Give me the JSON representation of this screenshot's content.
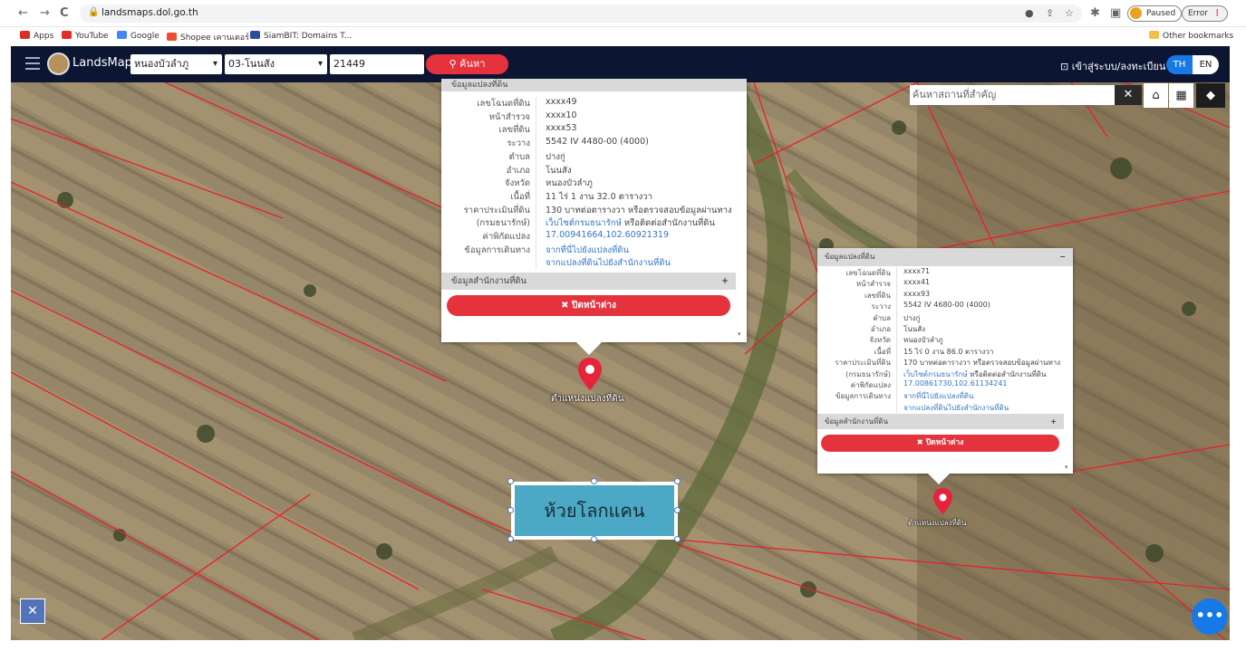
{
  "browser": {
    "url": "landsmaps.dol.go.th",
    "nav": {
      "back": "←",
      "forward": "→",
      "reload": "C"
    },
    "profile_status": "Paused",
    "error_chip": "Error",
    "bookmarks": [
      {
        "label": "Apps",
        "color": "#d93025"
      },
      {
        "label": "YouTube",
        "color": "#e52d27"
      },
      {
        "label": "Google",
        "color": "#4285f4"
      },
      {
        "label": "Shopee เคานเตอร์",
        "color": "#ee4d2d"
      },
      {
        "label": "SiamBIT: Domains T...",
        "color": "#2c4d9c"
      }
    ],
    "other_bookmarks": "Other bookmarks"
  },
  "topnav": {
    "brand": "LandsMaps",
    "province": "หนองบัวลำภู",
    "district": "03-โนนสัง",
    "parcel_no": "21449",
    "search_label": "ค้นหา",
    "login_label": "เข้าสู่ระบบ/ลงทะเบียน",
    "lang_th": "TH",
    "lang_en": "EN"
  },
  "map": {
    "search_placeholder": "ค้นหาสถานที่สำคัญ",
    "stream_label": "ห้วยโลกแคน",
    "colors": {
      "parcel_line": "#e8202a",
      "accent_red": "#e5333d",
      "nav_bg": "#0c1633",
      "link": "#3476c9"
    }
  },
  "popup_left": {
    "header": "ข้อมูลแปลงที่ดิน",
    "rows": [
      {
        "k": "เลขโฉนดที่ดิน",
        "v": "xxxx49"
      },
      {
        "k": "หน้าสำรวจ",
        "v": "xxxx10"
      },
      {
        "k": "เลขที่ดิน",
        "v": "xxxx53"
      },
      {
        "k": "ระวาง",
        "v": "5542 IV 4480-00 (4000)"
      },
      {
        "k": "ตำบล",
        "v": "ปางกู่"
      },
      {
        "k": "อำเภอ",
        "v": "โนนสัง"
      },
      {
        "k": "จังหวัด",
        "v": "หนองบัวลำภู"
      },
      {
        "k": "เนื้อที่",
        "v": "11 ไร่ 1 งาน 32.0 ตารางวา"
      },
      {
        "k": "ราคาประเมินที่ดิน",
        "v": "130 บาทต่อตารางวา หรือตรวจสอบข้อมูลผ่านทาง"
      },
      {
        "k": "(กรมธนารักษ์)",
        "v": "เว็บไซต์กรมธนารักษ์",
        "v2": " หรือติดต่อสำนักงานที่ดิน"
      },
      {
        "k": "ค่าพิกัดแปลง",
        "v": "17.00941664,102.60921319"
      },
      {
        "k": "ข้อมูลการเดินทาง",
        "v": "จากที่นี่ไปยังแปลงที่ดิน"
      },
      {
        "k": "",
        "v": "จากแปลงที่ดินไปยังสำนักงานที่ดิน"
      }
    ],
    "office_header": "ข้อมูลสำนักงานที่ดิน",
    "office_toggle": "+",
    "close_label": "✖ ปิดหน้าต่าง"
  },
  "popup_right": {
    "header": "ข้อมูลแปลงที่ดิน",
    "toggle": "−",
    "rows": [
      {
        "k": "เลขโฉนดที่ดิน",
        "v": "xxxx71"
      },
      {
        "k": "หน้าสำรวจ",
        "v": "xxxx41"
      },
      {
        "k": "เลขที่ดิน",
        "v": "xxxx93"
      },
      {
        "k": "ระวาง",
        "v": "5542 IV 4680-00 (4000)"
      },
      {
        "k": "ตำบล",
        "v": "ปางกู่"
      },
      {
        "k": "อำเภอ",
        "v": "โนนสัง"
      },
      {
        "k": "จังหวัด",
        "v": "หนองบัวลำภู"
      },
      {
        "k": "เนื้อที่",
        "v": "15 ไร่ 0 งาน 86.0 ตารางวา"
      },
      {
        "k": "ราคาประเมินที่ดิน",
        "v": "170 บาทต่อตารางวา หรือตรวจสอบข้อมูลผ่านทาง"
      },
      {
        "k": "(กรมธนารักษ์)",
        "v": "เว็บไซต์กรมธนารักษ์",
        "v2": " หรือติดต่อสำนักงานที่ดิน"
      },
      {
        "k": "ค่าพิกัดแปลง",
        "v": "17.00861730,102.61134241"
      },
      {
        "k": "ข้อมูลการเดินทาง",
        "v": "จากที่นี่ไปยังแปลงที่ดิน"
      },
      {
        "k": "",
        "v": "จากแปลงที่ดินไปยังสำนักงานที่ดิน"
      }
    ],
    "office_header": "ข้อมูลสำนักงานที่ดิน",
    "office_toggle": "+",
    "close_label": "✖ ปิดหน้าต่าง"
  },
  "markers": [
    {
      "label": "ตำแหน่งแปลงที่ดิน"
    },
    {
      "label": "ตำแหน่งแปลงที่ดิน"
    }
  ]
}
